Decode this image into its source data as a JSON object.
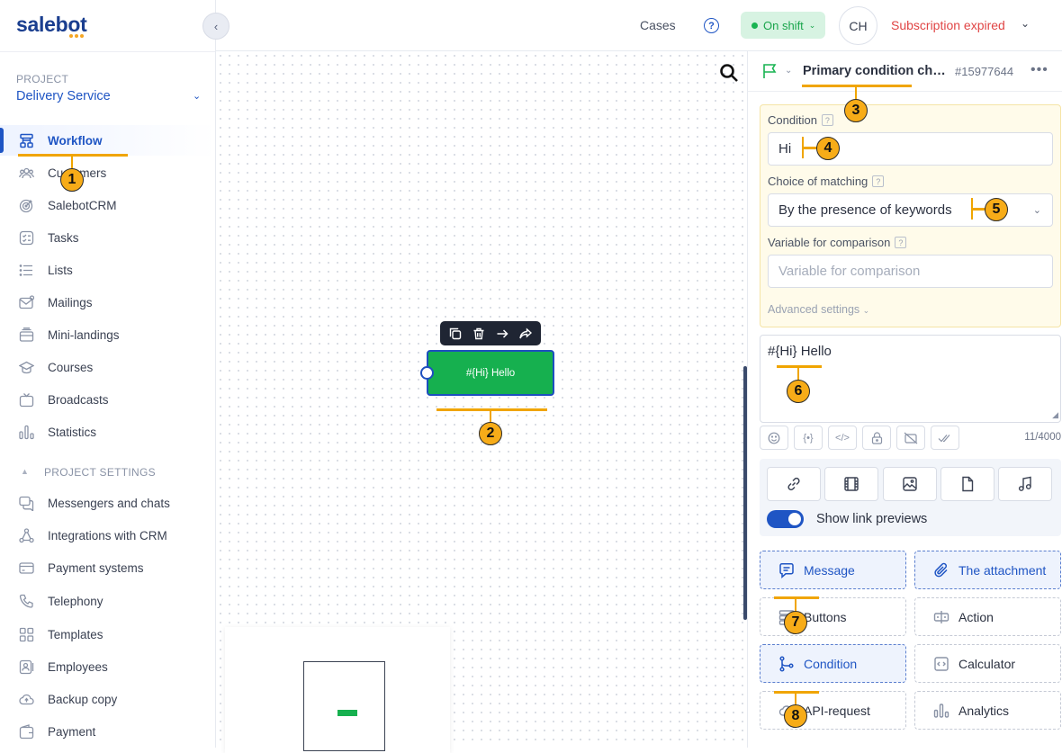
{
  "app": {
    "logo": "salebot",
    "brand_color": "#1a3e8f",
    "accent_color": "#1f55c4"
  },
  "sidebar": {
    "collapse_icon": "chevron-left-icon",
    "project_label": "PROJECT",
    "project_name": "Delivery Service",
    "items": [
      {
        "label": "Workflow",
        "icon": "workflow-icon",
        "active": true
      },
      {
        "label": "Customers",
        "icon": "users-icon"
      },
      {
        "label": "SalebotCRM",
        "icon": "target-icon"
      },
      {
        "label": "Tasks",
        "icon": "tasks-icon"
      },
      {
        "label": "Lists",
        "icon": "list-icon"
      },
      {
        "label": "Mailings",
        "icon": "mail-icon"
      },
      {
        "label": "Mini-landings",
        "icon": "landing-icon"
      },
      {
        "label": "Courses",
        "icon": "graduation-cap-icon"
      },
      {
        "label": "Broadcasts",
        "icon": "tv-icon"
      },
      {
        "label": "Statistics",
        "icon": "bar-chart-icon"
      }
    ],
    "settings_label": "PROJECT SETTINGS",
    "settings_items": [
      {
        "label": "Messengers and chats",
        "icon": "chat-icon"
      },
      {
        "label": "Integrations with CRM",
        "icon": "integration-icon"
      },
      {
        "label": "Payment systems",
        "icon": "credit-card-icon"
      },
      {
        "label": "Telephony",
        "icon": "phone-icon"
      },
      {
        "label": "Templates",
        "icon": "grid-icon"
      },
      {
        "label": "Employees",
        "icon": "employees-icon"
      },
      {
        "label": "Backup copy",
        "icon": "cloud-icon"
      },
      {
        "label": "Payment",
        "icon": "wallet-icon"
      }
    ]
  },
  "topbar": {
    "cases": "Cases",
    "help_icon": "?",
    "on_shift": "On shift",
    "on_shift_color": "#19b452",
    "avatar": "CH",
    "subscription": "Subscription expired",
    "subscription_color": "#e04545"
  },
  "canvas": {
    "node_label": "#{Hi} Hello",
    "node_color": "#16b04f",
    "toolbar_icons": [
      "copy-icon",
      "trash-icon",
      "arrow-right-icon",
      "share-icon"
    ]
  },
  "panel": {
    "title": "Primary condition che...",
    "block_id": "#15977644",
    "condition_label": "Condition",
    "condition_value": "Hi",
    "matching_label": "Choice of matching",
    "matching_value": "By the presence of keywords",
    "variable_label": "Variable for comparison",
    "variable_placeholder": "Variable for comparison",
    "advanced": "Advanced settings",
    "message_text": "#{Hi} Hello",
    "tool_icons": [
      "smile-icon",
      "variable-icon",
      "code-icon",
      "lock-icon",
      "no-preview-icon",
      "double-check-icon"
    ],
    "counter": "11/4000",
    "media_icons": [
      "link-icon",
      "video-icon",
      "image-icon",
      "file-icon",
      "music-icon"
    ],
    "link_previews": "Show link previews",
    "link_previews_on": true,
    "blocks": [
      {
        "label": "Message",
        "icon": "message-icon"
      },
      {
        "label": "The attachment",
        "icon": "attachment-icon"
      },
      {
        "label": "Buttons",
        "icon": "buttons-icon"
      },
      {
        "label": "Action",
        "icon": "action-icon"
      },
      {
        "label": "Condition",
        "icon": "branch-icon"
      },
      {
        "label": "Calculator",
        "icon": "calculator-icon"
      },
      {
        "label": "API-request",
        "icon": "api-cloud-icon"
      },
      {
        "label": "Analytics",
        "icon": "analytics-icon"
      }
    ]
  },
  "annotations": [
    "1",
    "2",
    "3",
    "4",
    "5",
    "6",
    "7",
    "8"
  ]
}
